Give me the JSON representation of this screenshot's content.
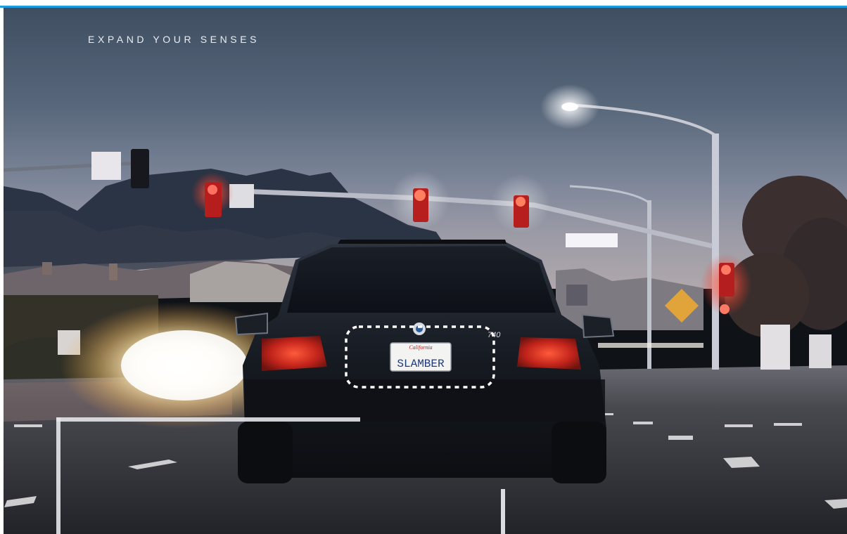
{
  "headline": "EXPAND YOUR SENSES",
  "license_plate": {
    "state_script": "California",
    "text": "SLAMBER"
  },
  "car_badge": "740"
}
